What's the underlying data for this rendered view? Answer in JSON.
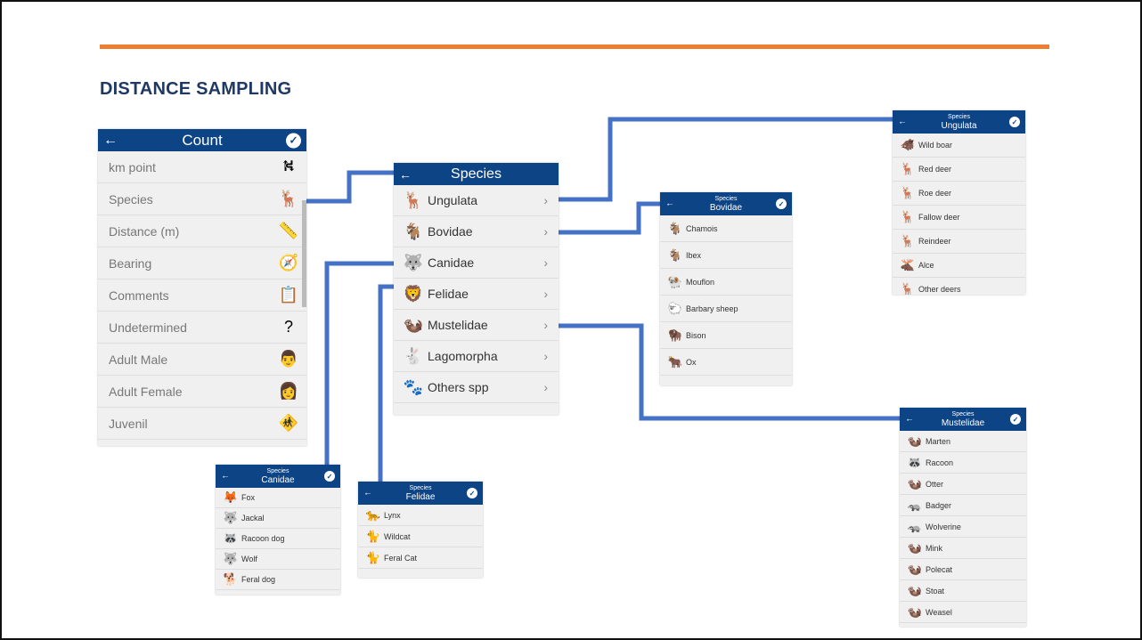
{
  "heading": "DISTANCE SAMPLING",
  "colors": {
    "accent_rule": "#ed7d31",
    "heading": "#1f3864",
    "connector": "#4472c4",
    "app_bar": "#0d4485"
  },
  "count_panel": {
    "title": "Count",
    "rows": [
      {
        "label": "km point",
        "icon": "road-icon",
        "glyph": "⛕"
      },
      {
        "label": "Species",
        "icon": "deer-eye-icon",
        "glyph": "🦌"
      },
      {
        "label": "Distance (m)",
        "icon": "ruler-icon",
        "glyph": "📏"
      },
      {
        "label": "Bearing",
        "icon": "compass-icon",
        "glyph": "🧭"
      },
      {
        "label": "Comments",
        "icon": "clipboard-icon",
        "glyph": "📋"
      },
      {
        "label": "Undetermined",
        "icon": "question-icon",
        "glyph": "?"
      },
      {
        "label": "Adult Male",
        "icon": "adult-male-icon",
        "glyph": "👨"
      },
      {
        "label": "Adult Female",
        "icon": "adult-female-icon",
        "glyph": "👩"
      },
      {
        "label": "Juvenil",
        "icon": "child-icon",
        "glyph": "🚸"
      }
    ]
  },
  "species_panel": {
    "title": "Species",
    "rows": [
      {
        "label": "Ungulata",
        "icon": "deer-icon",
        "glyph": "🦌"
      },
      {
        "label": "Bovidae",
        "icon": "goat-icon",
        "glyph": "🐐"
      },
      {
        "label": "Canidae",
        "icon": "wolf-icon",
        "glyph": "🐺"
      },
      {
        "label": "Felidae",
        "icon": "lion-icon",
        "glyph": "🦁"
      },
      {
        "label": "Mustelidae",
        "icon": "weasel-icon",
        "glyph": "🦦"
      },
      {
        "label": "Lagomorpha",
        "icon": "rabbit-icon",
        "glyph": "🐇"
      },
      {
        "label": "Others spp",
        "icon": "animal-icon",
        "glyph": "🐾"
      }
    ]
  },
  "ungulata_panel": {
    "title": "Species",
    "subtitle": "Ungulata",
    "rows": [
      {
        "label": "Wild boar",
        "icon": "boar-icon",
        "glyph": "🐗"
      },
      {
        "label": "Red deer",
        "icon": "red-deer-icon",
        "glyph": "🦌"
      },
      {
        "label": "Roe deer",
        "icon": "roe-deer-icon",
        "glyph": "🦌"
      },
      {
        "label": "Fallow deer",
        "icon": "fallow-deer-icon",
        "glyph": "🦌"
      },
      {
        "label": "Reindeer",
        "icon": "reindeer-icon",
        "glyph": "🦌"
      },
      {
        "label": "Alce",
        "icon": "moose-icon",
        "glyph": "🫎"
      },
      {
        "label": "Other deers",
        "icon": "deer-icon",
        "glyph": "🦌"
      }
    ]
  },
  "bovidae_panel": {
    "title": "Species",
    "subtitle": "Bovidae",
    "rows": [
      {
        "label": "Chamois",
        "icon": "chamois-icon",
        "glyph": "🐐"
      },
      {
        "label": "Ibex",
        "icon": "ibex-icon",
        "glyph": "🐐"
      },
      {
        "label": "Mouflon",
        "icon": "mouflon-icon",
        "glyph": "🐏"
      },
      {
        "label": "Barbary sheep",
        "icon": "barbary-sheep-icon",
        "glyph": "🐑"
      },
      {
        "label": "Bison",
        "icon": "bison-icon",
        "glyph": "🦬"
      },
      {
        "label": "Ox",
        "icon": "ox-icon",
        "glyph": "🐂"
      }
    ]
  },
  "mustelidae_panel": {
    "title": "Species",
    "subtitle": "Mustelidae",
    "rows": [
      {
        "label": "Marten",
        "icon": "marten-icon",
        "glyph": "🦦"
      },
      {
        "label": "Racoon",
        "icon": "racoon-icon",
        "glyph": "🦝"
      },
      {
        "label": "Otter",
        "icon": "otter-icon",
        "glyph": "🦦"
      },
      {
        "label": "Badger",
        "icon": "badger-icon",
        "glyph": "🦡"
      },
      {
        "label": "Wolverine",
        "icon": "wolverine-icon",
        "glyph": "🦡"
      },
      {
        "label": "Mink",
        "icon": "mink-icon",
        "glyph": "🦦"
      },
      {
        "label": "Polecat",
        "icon": "polecat-icon",
        "glyph": "🦦"
      },
      {
        "label": "Stoat",
        "icon": "stoat-icon",
        "glyph": "🦦"
      },
      {
        "label": "Weasel",
        "icon": "weasel-icon",
        "glyph": "🦦"
      }
    ]
  },
  "canidae_panel": {
    "title": "Species",
    "subtitle": "Canidae",
    "rows": [
      {
        "label": "Fox",
        "icon": "fox-icon",
        "glyph": "🦊"
      },
      {
        "label": "Jackal",
        "icon": "jackal-icon",
        "glyph": "🐺"
      },
      {
        "label": "Racoon dog",
        "icon": "racoon-dog-icon",
        "glyph": "🦝"
      },
      {
        "label": "Wolf",
        "icon": "wolf-icon",
        "glyph": "🐺"
      },
      {
        "label": "Feral dog",
        "icon": "dog-icon",
        "glyph": "🐕"
      }
    ]
  },
  "felidae_panel": {
    "title": "Species",
    "subtitle": "Felidae",
    "rows": [
      {
        "label": "Lynx",
        "icon": "lynx-icon",
        "glyph": "🐆"
      },
      {
        "label": "Wildcat",
        "icon": "wildcat-icon",
        "glyph": "🐈"
      },
      {
        "label": "Feral Cat",
        "icon": "cat-icon",
        "glyph": "🐈"
      }
    ]
  }
}
